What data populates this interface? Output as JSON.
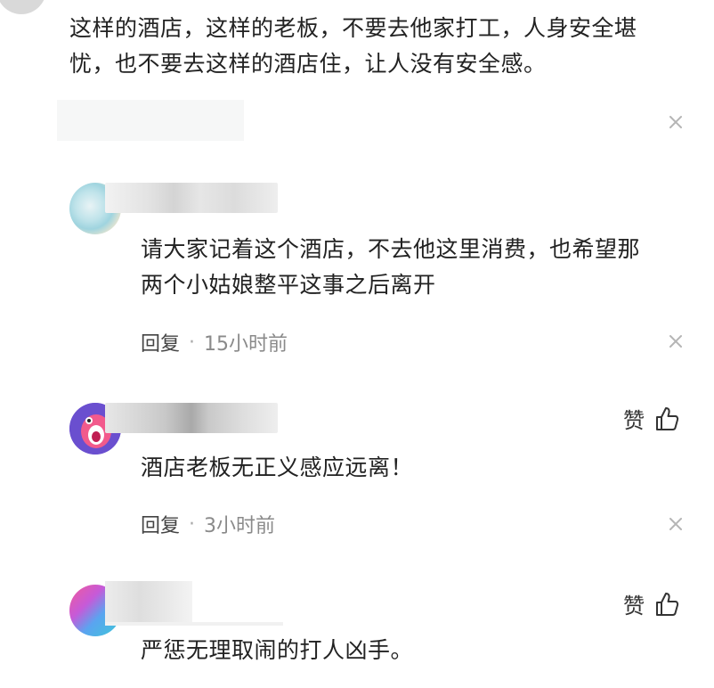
{
  "comments": [
    {
      "text_line1": "这样的酒店，这样的老板，不要去他家打工，人身安全堪",
      "text_line2": "忧，也不要去这样的酒店住，让人没有安全感。"
    },
    {
      "text_line1": "请大家记着这个酒店，不去他这里消费，也希望那",
      "text_line2": "两个小姑娘整平这事之后离开",
      "reply_label": "回复",
      "separator": "·",
      "time": "15小时前"
    },
    {
      "text": "酒店老板无正义感应远离！",
      "like_label": "赞",
      "reply_label": "回复",
      "separator": "·",
      "time": "3小时前"
    },
    {
      "text": "严惩无理取闹的打人凶手。",
      "like_label": "赞"
    }
  ],
  "icons": {
    "close": "close-icon",
    "like": "thumbs-up-icon",
    "avatar": "avatar"
  },
  "colors": {
    "text": "#222222",
    "meta": "#8a8a8a",
    "icon": "#b5b5b5"
  }
}
